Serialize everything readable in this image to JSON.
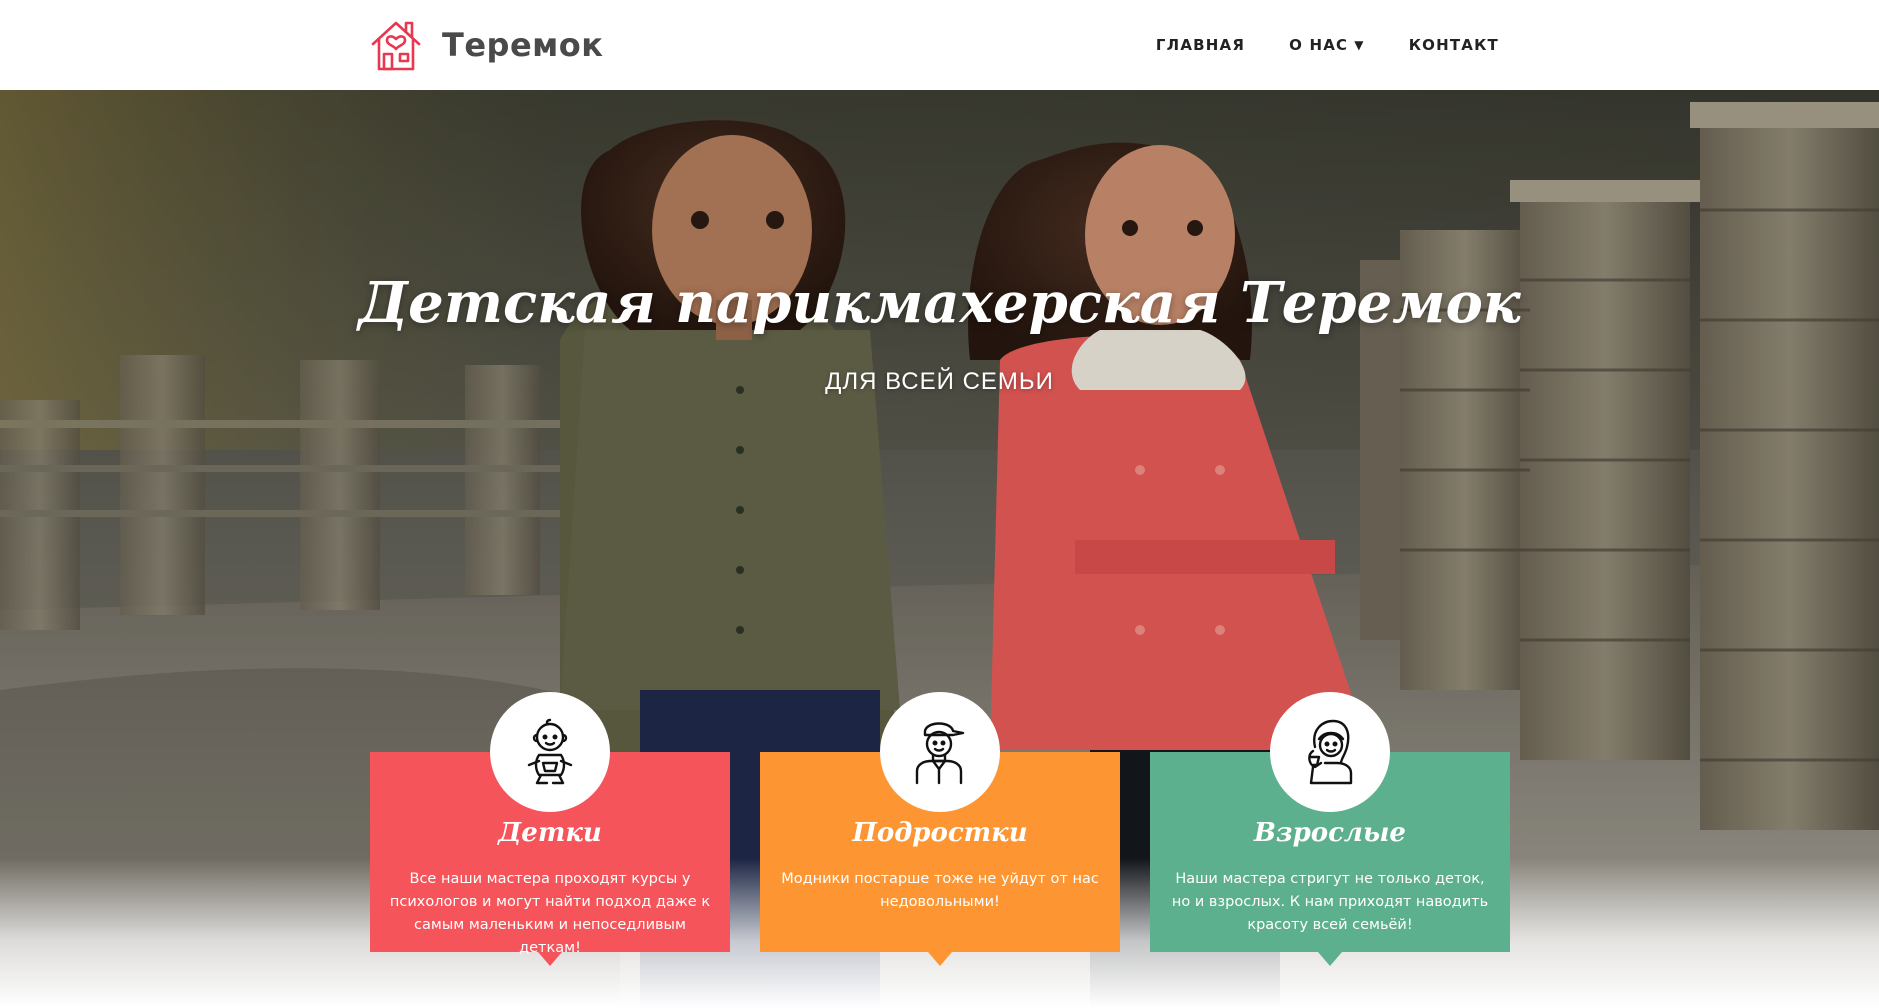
{
  "header": {
    "brand_name": "Теремок",
    "logo_icon": "house-heart-icon",
    "nav": [
      {
        "label": "ГЛАВНАЯ"
      },
      {
        "label": "О НАС",
        "caret": "▼"
      },
      {
        "label": "КОНТАКТ"
      }
    ]
  },
  "hero": {
    "title": "Детская парикмахерская Теремок",
    "subtitle": "ДЛЯ ВСЕЙ СЕМЬИ",
    "background_photo": "two-children-walking-photo"
  },
  "features": [
    {
      "title": "Детки",
      "text": "Все наши мастера проходят курсы у психологов и могут найти подход даже к самым маленьким и непоседливым деткам!",
      "icon": "baby-icon",
      "color": "#f5545a"
    },
    {
      "title": "Подростки",
      "text": "Модники постарше тоже не уйдут от нас недовольными!",
      "icon": "teenager-cap-icon",
      "color": "#fd9632"
    },
    {
      "title": "Взрослые",
      "text": "Наши мастера стригут не только деток, но и взрослых. К нам приходят наводить красоту всей семьёй!",
      "icon": "woman-icon",
      "color": "#5db08d"
    }
  ],
  "colors": {
    "brand_red": "#e8384f",
    "text_dark": "#222222"
  }
}
